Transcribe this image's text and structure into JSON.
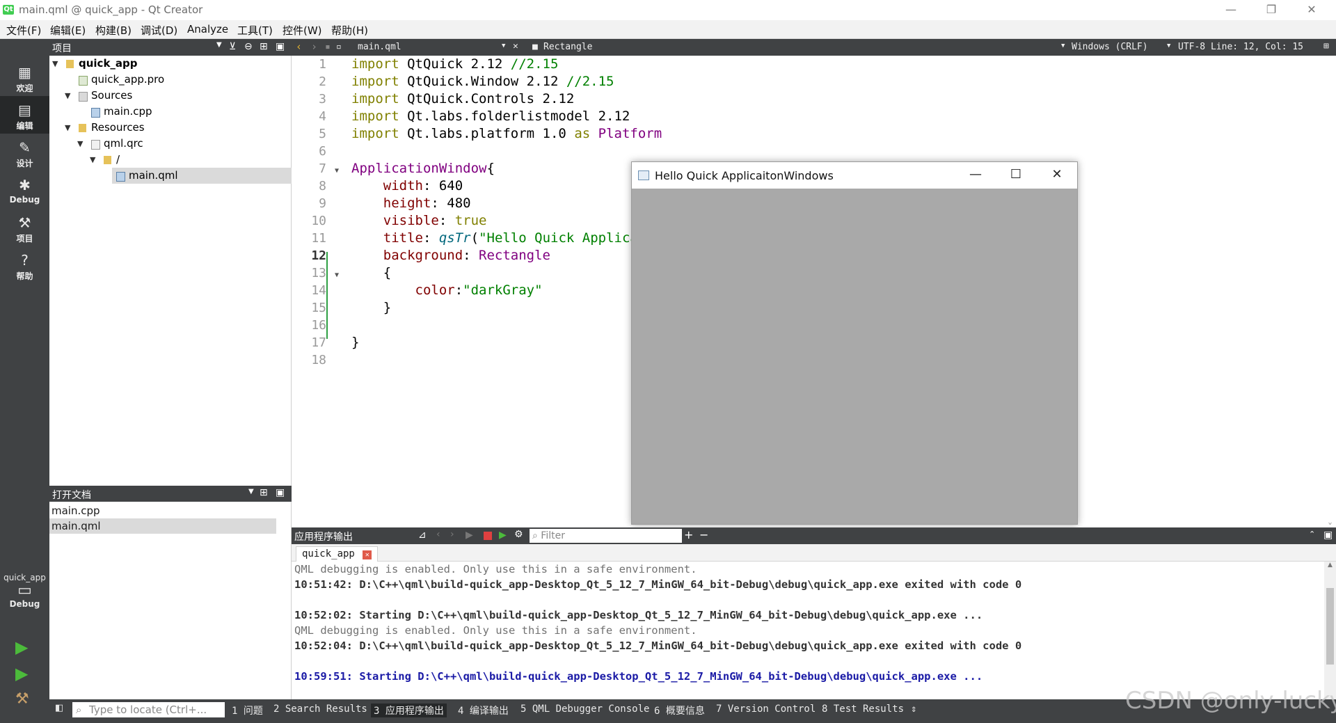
{
  "window": {
    "title": "main.qml @ quick_app - Qt Creator",
    "app_icon": "Qt"
  },
  "menu": [
    "文件(F)",
    "编辑(E)",
    "构建(B)",
    "调试(D)",
    "Analyze",
    "工具(T)",
    "控件(W)",
    "帮助(H)"
  ],
  "modes": [
    {
      "label": "欢迎",
      "icon": "grid-icon"
    },
    {
      "label": "编辑",
      "icon": "document-icon"
    },
    {
      "label": "设计",
      "icon": "pencil-icon"
    },
    {
      "label": "Debug",
      "icon": "bug-icon"
    },
    {
      "label": "项目",
      "icon": "wrench-icon"
    },
    {
      "label": "帮助",
      "icon": "help-icon"
    }
  ],
  "kit": {
    "project": "quick_app",
    "config": "Debug"
  },
  "projects_pane": {
    "title": "项目",
    "tree": [
      {
        "label": "quick_app",
        "bold": true
      },
      {
        "label": "quick_app.pro"
      },
      {
        "label": "Sources"
      },
      {
        "label": "main.cpp"
      },
      {
        "label": "Resources"
      },
      {
        "label": "qml.qrc"
      },
      {
        "label": "/"
      },
      {
        "label": "main.qml",
        "selected": true
      }
    ]
  },
  "open_docs": {
    "title": "打开文档",
    "items": [
      "main.cpp",
      "main.qml"
    ]
  },
  "editor_bar": {
    "file": "main.qml",
    "symbol": "Rectangle",
    "line_ending": "Windows (CRLF)",
    "position": "UTF-8 Line: 12, Col: 15"
  },
  "editor": {
    "line_numbers": [
      "1",
      "2",
      "3",
      "4",
      "5",
      "6",
      "7",
      "8",
      "9",
      "10",
      "11",
      "12",
      "13",
      "14",
      "15",
      "16",
      "17",
      "18"
    ],
    "current_line": "12"
  },
  "hello_window": {
    "title": "Hello Quick ApplicaitonWindows",
    "background": "#a9a9a9"
  },
  "output": {
    "title": "应用程序输出",
    "filter_placeholder": "Filter",
    "tab": "quick_app",
    "lines": [
      "QML debugging is enabled. Only use this in a safe environment.",
      "10:51:42: D:\\C++\\qml\\build-quick_app-Desktop_Qt_5_12_7_MinGW_64_bit-Debug\\debug\\quick_app.exe exited with code 0",
      "",
      "10:52:02: Starting D:\\C++\\qml\\build-quick_app-Desktop_Qt_5_12_7_MinGW_64_bit-Debug\\debug\\quick_app.exe ...",
      "QML debugging is enabled. Only use this in a safe environment.",
      "10:52:04: D:\\C++\\qml\\build-quick_app-Desktop_Qt_5_12_7_MinGW_64_bit-Debug\\debug\\quick_app.exe exited with code 0",
      "",
      "10:59:51: Starting D:\\C++\\qml\\build-quick_app-Desktop_Qt_5_12_7_MinGW_64_bit-Debug\\debug\\quick_app.exe ..."
    ]
  },
  "status": {
    "locate_placeholder": "Type to locate (Ctrl+...",
    "tabs": [
      "1 问题",
      "2 Search Results",
      "3 应用程序输出",
      "4 编译输出",
      "5 QML Debugger Console",
      "6 概要信息",
      "7 Version Control",
      "8 Test Results"
    ]
  },
  "watermark": "CSDN @only-lucky"
}
